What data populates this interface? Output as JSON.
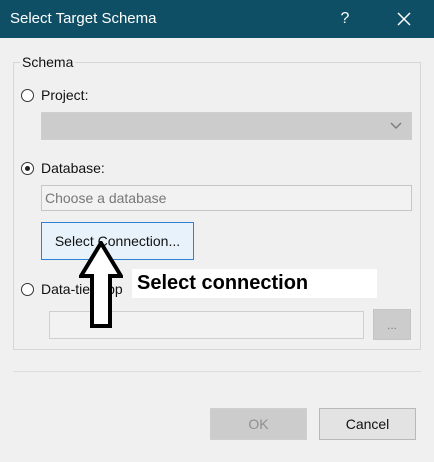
{
  "window": {
    "title": "Select Target Schema",
    "help_label": "?",
    "close_icon": "close-icon",
    "titlebar_color": "#0f4f66"
  },
  "schema_group": {
    "label": "Schema",
    "project": {
      "label": "Project:",
      "checked": false,
      "dropdown_value": "",
      "dropdown_icon": "chevron-down-icon"
    },
    "database": {
      "label": "Database:",
      "checked": true,
      "placeholder": "Choose a database",
      "select_connection_label": "Select Connection..."
    },
    "data_tier": {
      "label": "Data-tier App",
      "checked": false,
      "path_value": "",
      "browse_label": "..."
    }
  },
  "footer": {
    "ok_label": "OK",
    "cancel_label": "Cancel"
  },
  "annotation": {
    "label": "Select connection",
    "arrow_icon": "up-arrow-icon"
  }
}
